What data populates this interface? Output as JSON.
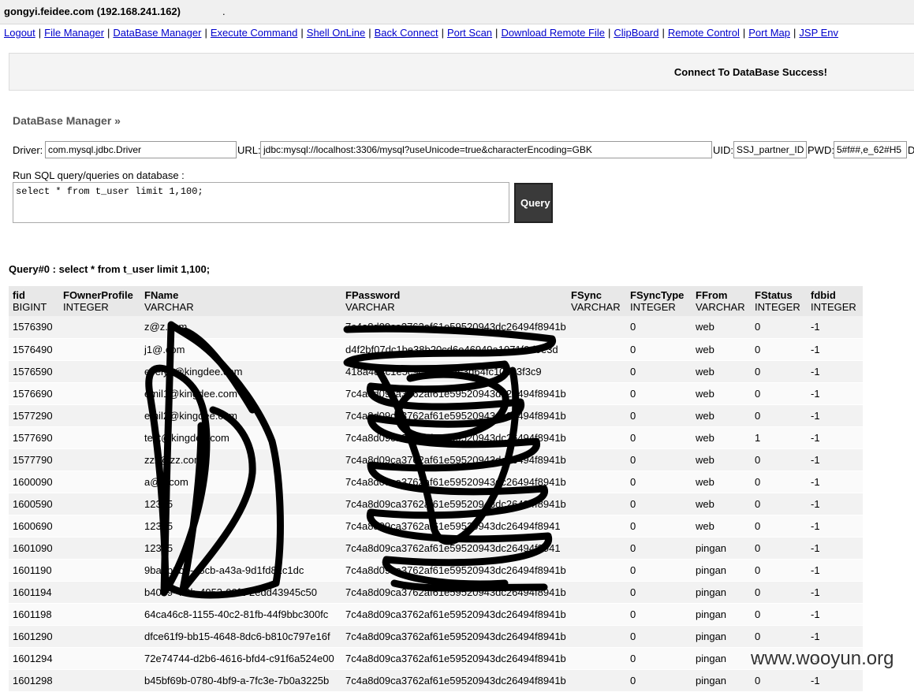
{
  "host": "gongyi.feidee.com (192.168.241.162)",
  "host_dot": ".",
  "nav": [
    "Logout",
    "File Manager",
    "DataBase Manager",
    "Execute Command",
    "Shell OnLine",
    "Back Connect",
    "Port Scan",
    "Download Remote File",
    "ClipBoard",
    "Remote Control",
    "Port Map",
    "JSP Env"
  ],
  "message": "Connect To DataBase Success!",
  "section_title": "DataBase Manager »",
  "form": {
    "driver_label": "Driver:",
    "driver_value": "com.mysql.jdbc.Driver",
    "url_label": "URL:",
    "url_value": "jdbc:mysql://localhost:3306/mysql?useUnicode=true&characterEncoding=GBK",
    "uid_label": "UID:",
    "uid_value": "SSJ_partner_ID",
    "pwd_label": "PWD:",
    "pwd_value": "5#f##,e_62#H5",
    "trailing": "D",
    "sql_label": "Run SQL query/queries on database :",
    "sql_value": "select * from t_user limit 1,100;",
    "query_button": "Query"
  },
  "query_title": "Query#0 : select * from t_user limit 1,100;",
  "columns": [
    {
      "name": "fid",
      "type": "BIGINT"
    },
    {
      "name": "FOwnerProfile",
      "type": "INTEGER"
    },
    {
      "name": "FName",
      "type": "VARCHAR"
    },
    {
      "name": "FPassword",
      "type": "VARCHAR"
    },
    {
      "name": "FSync",
      "type": "VARCHAR"
    },
    {
      "name": "FSyncType",
      "type": "INTEGER"
    },
    {
      "name": "FFrom",
      "type": "VARCHAR"
    },
    {
      "name": "FStatus",
      "type": "INTEGER"
    },
    {
      "name": "fdbid",
      "type": "INTEGER"
    }
  ],
  "rows": [
    [
      "1576390",
      "",
      "z@z.com",
      "7c4a8d09ca3762af61e59520943dc26494f8941b",
      "",
      "0",
      "web",
      "0",
      "-1"
    ],
    [
      "1576490",
      "",
      "j1@.com",
      "d4f2bf07dc1be38b20cd6e46949a1071f9d0e3d",
      "",
      "0",
      "web",
      "0",
      "-1"
    ],
    [
      "1576590",
      "",
      "evelyn@kingdee.com",
      "418a4d4c1e5c9c5a7212c3d64fc104b3f3c9",
      "",
      "0",
      "web",
      "0",
      "-1"
    ],
    [
      "1576690",
      "",
      "emil1@kingdee.com",
      "7c4a8d09ca3762af61e59520943dc26494f8941b",
      "",
      "0",
      "web",
      "0",
      "-1"
    ],
    [
      "1577290",
      "",
      "emil2@kingdee.com",
      "7c4a8d09ca3762af61e59520943dc26494f8941b",
      "",
      "0",
      "web",
      "0",
      "-1"
    ],
    [
      "1577690",
      "",
      "test@kingdee.com",
      "7c4a8d09ca3762af61e59520943dc26494f8941b",
      "",
      "0",
      "web",
      "1",
      "-1"
    ],
    [
      "1577790",
      "",
      "zzz@zz.com",
      "7c4a8d09ca3762af61e59520943dc26494f8941b",
      "",
      "0",
      "web",
      "0",
      "-1"
    ],
    [
      "1600090",
      "",
      "a@a.com",
      "7c4a8d09ca3762af61e59520943dc26494f8941b",
      "",
      "0",
      "web",
      "0",
      "-1"
    ],
    [
      "1600590",
      "",
      "12345",
      "7c4a8d09ca3762af61e59520943dc26494f8941b",
      "",
      "0",
      "web",
      "0",
      "-1"
    ],
    [
      "1600690",
      "",
      "12345",
      "7c4a8d09ca3762af61e59520943dc26494f8941",
      "",
      "0",
      "web",
      "0",
      "-1"
    ],
    [
      "1601090",
      "",
      "12345",
      "7c4a8d09ca3762af61e59520943dc26494f8941",
      "",
      "0",
      "pingan",
      "0",
      "-1"
    ],
    [
      "1601190",
      "",
      "9ba0b3b2-48cb-a43a-9d1fd82c1dc",
      "7c4a8d09ca3762af61e59520943dc26494f8941b",
      "",
      "0",
      "pingan",
      "0",
      "-1"
    ],
    [
      "1601194",
      "",
      "b4059-4f9b-4953-99f1-2edd43945c50",
      "7c4a8d09ca3762af61e59520943dc26494f8941b",
      "",
      "0",
      "pingan",
      "0",
      "-1"
    ],
    [
      "1601198",
      "",
      "64ca46c8-1155-40c2-81fb-44f9bbc300fc",
      "7c4a8d09ca3762af61e59520943dc26494f8941b",
      "",
      "0",
      "pingan",
      "0",
      "-1"
    ],
    [
      "1601290",
      "",
      "dfce61f9-bb15-4648-8dc6-b810c797e16f",
      "7c4a8d09ca3762af61e59520943dc26494f8941b",
      "",
      "0",
      "pingan",
      "0",
      "-1"
    ],
    [
      "1601294",
      "",
      "72e74744-d2b6-4616-bfd4-c91f6a524e00",
      "7c4a8d09ca3762af61e59520943dc26494f8941b",
      "",
      "0",
      "pingan",
      "0",
      "-1"
    ],
    [
      "1601298",
      "",
      "b45bf69b-0780-4bf9-a-7fc3e-7b0a3225b",
      "7c4a8d09ca3762af61e59520943dc26494f8941b",
      "",
      "0",
      "pingan",
      "0",
      "-1"
    ]
  ],
  "watermark": "www.wooyun.org"
}
